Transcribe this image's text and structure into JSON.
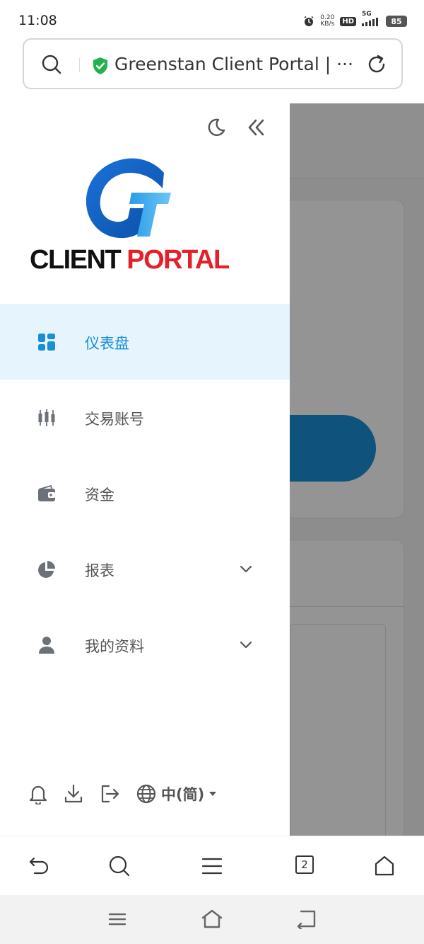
{
  "status_bar": {
    "time": "11:08",
    "net_speed_value": "0.20",
    "net_speed_unit": "KB/s",
    "hd_label": "HD",
    "network_label": "5G",
    "battery": "85"
  },
  "url_bar": {
    "title": "Greenstan Client Portal | ···"
  },
  "logo": {
    "client": "CLIENT",
    "portal": "PORTAL"
  },
  "menu": {
    "items": [
      {
        "label": "仪表盘",
        "icon": "dashboard-icon",
        "active": true
      },
      {
        "label": "交易账号",
        "icon": "candlestick-icon",
        "active": false
      },
      {
        "label": "资金",
        "icon": "wallet-icon",
        "active": false
      },
      {
        "label": "报表",
        "icon": "pie-chart-icon",
        "active": false,
        "expandable": true
      },
      {
        "label": "我的资料",
        "icon": "user-icon",
        "active": false,
        "expandable": true
      }
    ]
  },
  "footer": {
    "language": "中(简)"
  },
  "toolbar": {
    "tab_count": "2"
  },
  "colors": {
    "accent": "#1a8ed6",
    "active_bg": "#e6f4fd",
    "logo_red": "#e4202a"
  }
}
